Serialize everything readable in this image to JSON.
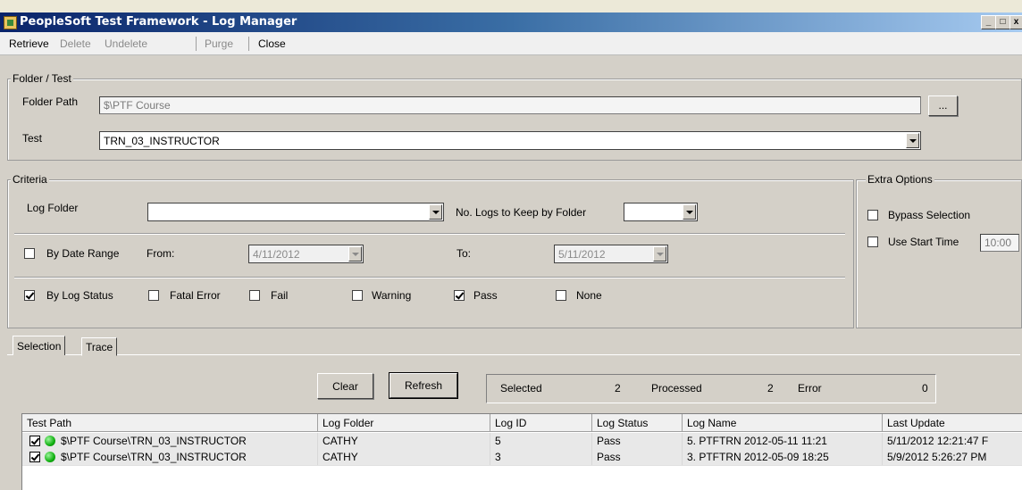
{
  "window": {
    "title": "PeopleSoft Test Framework - Log Manager"
  },
  "toolbar": {
    "retrieve": "Retrieve",
    "delete": "Delete",
    "undelete": "Undelete",
    "purge": "Purge",
    "close": "Close"
  },
  "folder_test": {
    "legend": "Folder / Test",
    "folder_path_label": "Folder Path",
    "folder_path_value": "$\\PTF Course",
    "browse_label": "...",
    "test_label": "Test",
    "test_value": "TRN_03_INSTRUCTOR"
  },
  "criteria": {
    "legend": "Criteria",
    "log_folder_label": "Log Folder",
    "log_folder_value": "",
    "logs_to_keep_label": "No. Logs to Keep by Folder",
    "logs_to_keep_value": "",
    "by_date_range_label": "By Date Range",
    "by_date_range_checked": false,
    "from_label": "From:",
    "from_value": "4/11/2012",
    "to_label": "To:",
    "to_value": "5/11/2012",
    "by_log_status_label": "By Log Status",
    "by_log_status_checked": true,
    "fatal_error_label": "Fatal Error",
    "fail_label": "Fail",
    "warning_label": "Warning",
    "pass_label": "Pass",
    "pass_checked": true,
    "none_label": "None"
  },
  "extra_options": {
    "legend": "Extra Options",
    "bypass_selection_label": "Bypass Selection",
    "use_start_time_label": "Use Start Time",
    "start_time_value": "10:00"
  },
  "tabs": [
    "Selection",
    "Trace"
  ],
  "actions": {
    "clear": "Clear",
    "refresh": "Refresh"
  },
  "status": {
    "selected_label": "Selected",
    "selected_value": "2",
    "processed_label": "Processed",
    "processed_value": "2",
    "error_label": "Error",
    "error_value": "0"
  },
  "grid": {
    "columns": [
      "Test Path",
      "Log Folder",
      "Log ID",
      "Log Status",
      "Log Name",
      "Last Update"
    ],
    "rows": [
      {
        "test_path": "$\\PTF Course\\TRN_03_INSTRUCTOR",
        "log_folder": "CATHY",
        "log_id": "5",
        "log_status": "Pass",
        "log_name": "5. PTFTRN 2012-05-11 11:21",
        "last_update": "5/11/2012 12:21:47 F"
      },
      {
        "test_path": "$\\PTF Course\\TRN_03_INSTRUCTOR",
        "log_folder": "CATHY",
        "log_id": "3",
        "log_status": "Pass",
        "log_name": "3. PTFTRN 2012-05-09 18:25",
        "last_update": "5/9/2012 5:26:27 PM"
      }
    ]
  },
  "colors": {
    "title_bar": "#0a246a",
    "pass_indicator": "#10b010",
    "window_bg": "#d4d0c8"
  }
}
